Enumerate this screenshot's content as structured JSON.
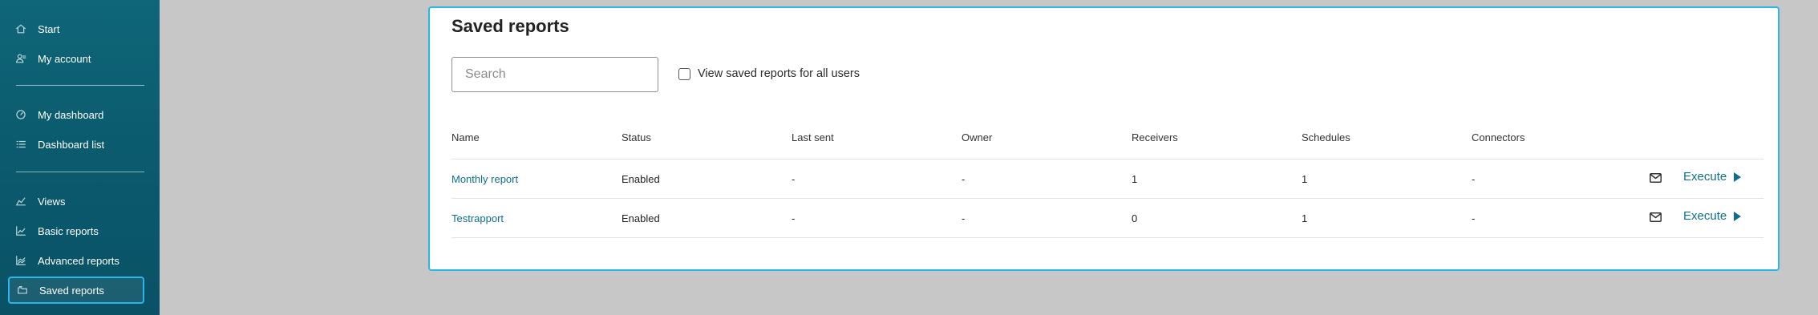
{
  "sidebar": {
    "items": [
      {
        "label": "Start",
        "icon": "home-icon"
      },
      {
        "label": "My account",
        "icon": "user-icon"
      },
      {
        "label": "My dashboard",
        "icon": "gauge-icon"
      },
      {
        "label": "Dashboard list",
        "icon": "list-icon"
      },
      {
        "label": "Views",
        "icon": "views-chart-icon"
      },
      {
        "label": "Basic reports",
        "icon": "line-chart-icon"
      },
      {
        "label": "Advanced reports",
        "icon": "advanced-chart-icon"
      },
      {
        "label": "Saved reports",
        "icon": "folder-icon",
        "active": true
      }
    ],
    "background": "#0b5b6e",
    "active_border_color": "#29b6e8"
  },
  "main": {
    "title": "Saved reports",
    "search": {
      "placeholder": "Search",
      "value": ""
    },
    "view_all_checkbox": {
      "label": "View saved reports for all users",
      "checked": false
    },
    "table": {
      "columns": [
        "Name",
        "Status",
        "Last sent",
        "Owner",
        "Receivers",
        "Schedules",
        "Connectors"
      ],
      "rows": [
        {
          "name": "Monthly report",
          "status": "Enabled",
          "last_sent": "-",
          "owner": "-",
          "receivers": "1",
          "schedules": "1",
          "connectors": "-",
          "action": "Execute"
        },
        {
          "name": "Testrapport",
          "status": "Enabled",
          "last_sent": "-",
          "owner": "-",
          "receivers": "0",
          "schedules": "1",
          "connectors": "-",
          "action": "Execute"
        }
      ]
    },
    "accent_color": "#0e6f8a",
    "card_border_color": "#29b6e8"
  }
}
